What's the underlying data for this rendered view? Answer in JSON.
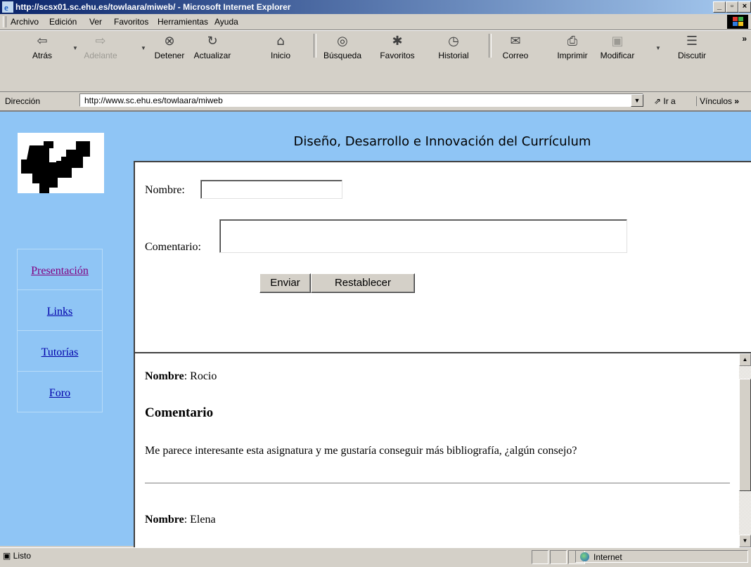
{
  "window": {
    "title": "http://scsx01.sc.ehu.es/towlaara/miweb/ - Microsoft Internet Explorer",
    "controls": {
      "minimize": "_",
      "maximize": "▫",
      "close": "×"
    }
  },
  "menu": [
    "Archivo",
    "Edición",
    "Ver",
    "Favoritos",
    "Herramientas",
    "Ayuda"
  ],
  "toolbar": {
    "buttons": [
      {
        "label": "Atrás",
        "icon": "back-arrow-icon",
        "glyph": "⇦"
      },
      {
        "label": "Adelante",
        "icon": "forward-arrow-icon",
        "glyph": "⇨"
      },
      {
        "label": "Detener",
        "icon": "stop-icon",
        "glyph": "⊗"
      },
      {
        "label": "Actualizar",
        "icon": "refresh-icon",
        "glyph": "↻"
      },
      {
        "label": "Inicio",
        "icon": "home-icon",
        "glyph": "⌂"
      },
      {
        "label": "Búsqueda",
        "icon": "search-icon",
        "glyph": "◎"
      },
      {
        "label": "Favoritos",
        "icon": "favorites-icon",
        "glyph": "✱"
      },
      {
        "label": "Historial",
        "icon": "history-icon",
        "glyph": "◷"
      },
      {
        "label": "Correo",
        "icon": "mail-icon",
        "glyph": "✉"
      },
      {
        "label": "Imprimir",
        "icon": "print-icon",
        "glyph": "⎙"
      },
      {
        "label": "Modificar",
        "icon": "edit-icon",
        "glyph": "▣"
      },
      {
        "label": "Discutir",
        "icon": "discuss-icon",
        "glyph": "☰"
      }
    ],
    "more": "»"
  },
  "address": {
    "label": "Dirección",
    "url": "http://www.sc.ehu.es/towlaara/miweb",
    "go": "Ir a",
    "links": "Vínculos"
  },
  "page": {
    "header": "Diseño, Desarrollo e Innovación del Currículum",
    "nav": [
      {
        "label": "Presentación",
        "visited": true
      },
      {
        "label": "Links",
        "visited": false
      },
      {
        "label": "Tutorías",
        "visited": false
      },
      {
        "label": "Foro",
        "visited": false
      }
    ],
    "form": {
      "name_label": "Nombre:",
      "name_value": "",
      "comment_label": "Comentario:",
      "comment_value": "",
      "submit": "Enviar",
      "reset": "Restablecer"
    },
    "comments": [
      {
        "name_label": "Nombre",
        "name": ": Rocio",
        "heading": "Comentario",
        "text": "Me parece interesante esta asignatura y me gustaría conseguir más bibliografía, ¿algún consejo?"
      },
      {
        "name_label": "Nombre",
        "name": ": Elena"
      }
    ]
  },
  "status": {
    "text": "Listo",
    "zone": "Internet"
  },
  "colors": {
    "title_gradient_start": "#0a246a",
    "title_gradient_end": "#a6caf0",
    "page_background": "#8fc5f5",
    "chrome": "#d4d0c8"
  }
}
